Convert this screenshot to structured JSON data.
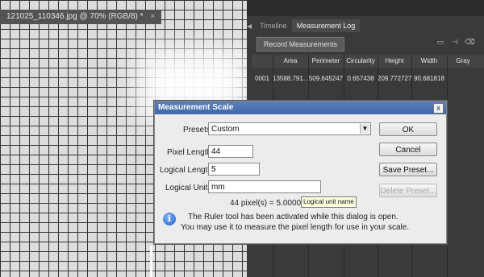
{
  "document": {
    "tab_title": "121025_110346.jpg @ 70% (RGB/8) *",
    "close_glyph": "×"
  },
  "panel": {
    "tabs": [
      "Timeline",
      "Measurement Log"
    ],
    "active_tab": "Measurement Log",
    "record_button": "Record Measurements",
    "columns": [
      "",
      "Area",
      "Perimeter",
      "Circularity",
      "Height",
      "Width",
      "Gray"
    ],
    "rows": [
      [
        "0001",
        "13588.791...",
        "509.645247",
        "0.657438",
        "209.772727",
        "90.681818",
        ""
      ]
    ],
    "icons": [
      "export-icon",
      "delete-column-icon",
      "delete-icon"
    ]
  },
  "dialog": {
    "title": "Measurement Scale",
    "close_glyph": "x",
    "presets_label": "Presets:",
    "presets_value": "Custom",
    "pixel_length_label": "Pixel Length:",
    "pixel_length_value": "44",
    "logical_length_label": "Logical Length:",
    "logical_length_value": "5",
    "logical_units_label": "Logical Units:",
    "logical_units_value": "mm",
    "equation": "44 pixel(s) = 5.0000 mm",
    "tooltip": "Logical unit name",
    "info_line1": "The Ruler tool has been activated while this dialog is open.",
    "info_line2": "You may use it to measure the pixel length for use in your scale.",
    "buttons": {
      "ok": "OK",
      "cancel": "Cancel",
      "save_preset": "Save Preset...",
      "delete_preset": "Delete Preset..."
    }
  }
}
